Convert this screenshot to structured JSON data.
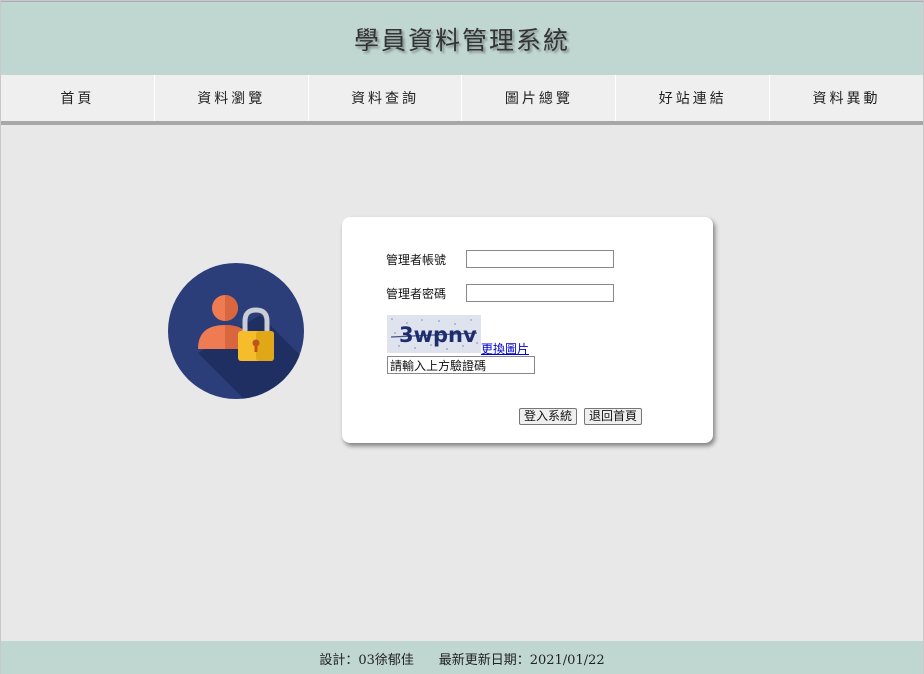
{
  "header": {
    "title": "學員資料管理系統"
  },
  "nav": {
    "items": [
      {
        "label": "首頁"
      },
      {
        "label": "資料瀏覽"
      },
      {
        "label": "資料查詢"
      },
      {
        "label": "圖片總覽"
      },
      {
        "label": "好站連結"
      },
      {
        "label": "資料異動"
      }
    ]
  },
  "login": {
    "account_label": "管理者帳號",
    "account_value": "",
    "password_label": "管理者密碼",
    "password_value": "",
    "captcha_text": "3wpnv",
    "refresh_link": "更換圖片",
    "captcha_input_value": "請輸入上方驗證碼",
    "login_button": "登入系統",
    "home_button": "退回首頁"
  },
  "footer": {
    "designer": "設計：03徐郁佳",
    "updated": "最新更新日期：2021/01/22"
  },
  "colors": {
    "header_bg": "#c0d6d1",
    "page_bg": "#e8e8e8",
    "avatar_circle": "#2c3e7a",
    "avatar_person": "#ef7b52",
    "lock_body": "#f5bd2b"
  }
}
